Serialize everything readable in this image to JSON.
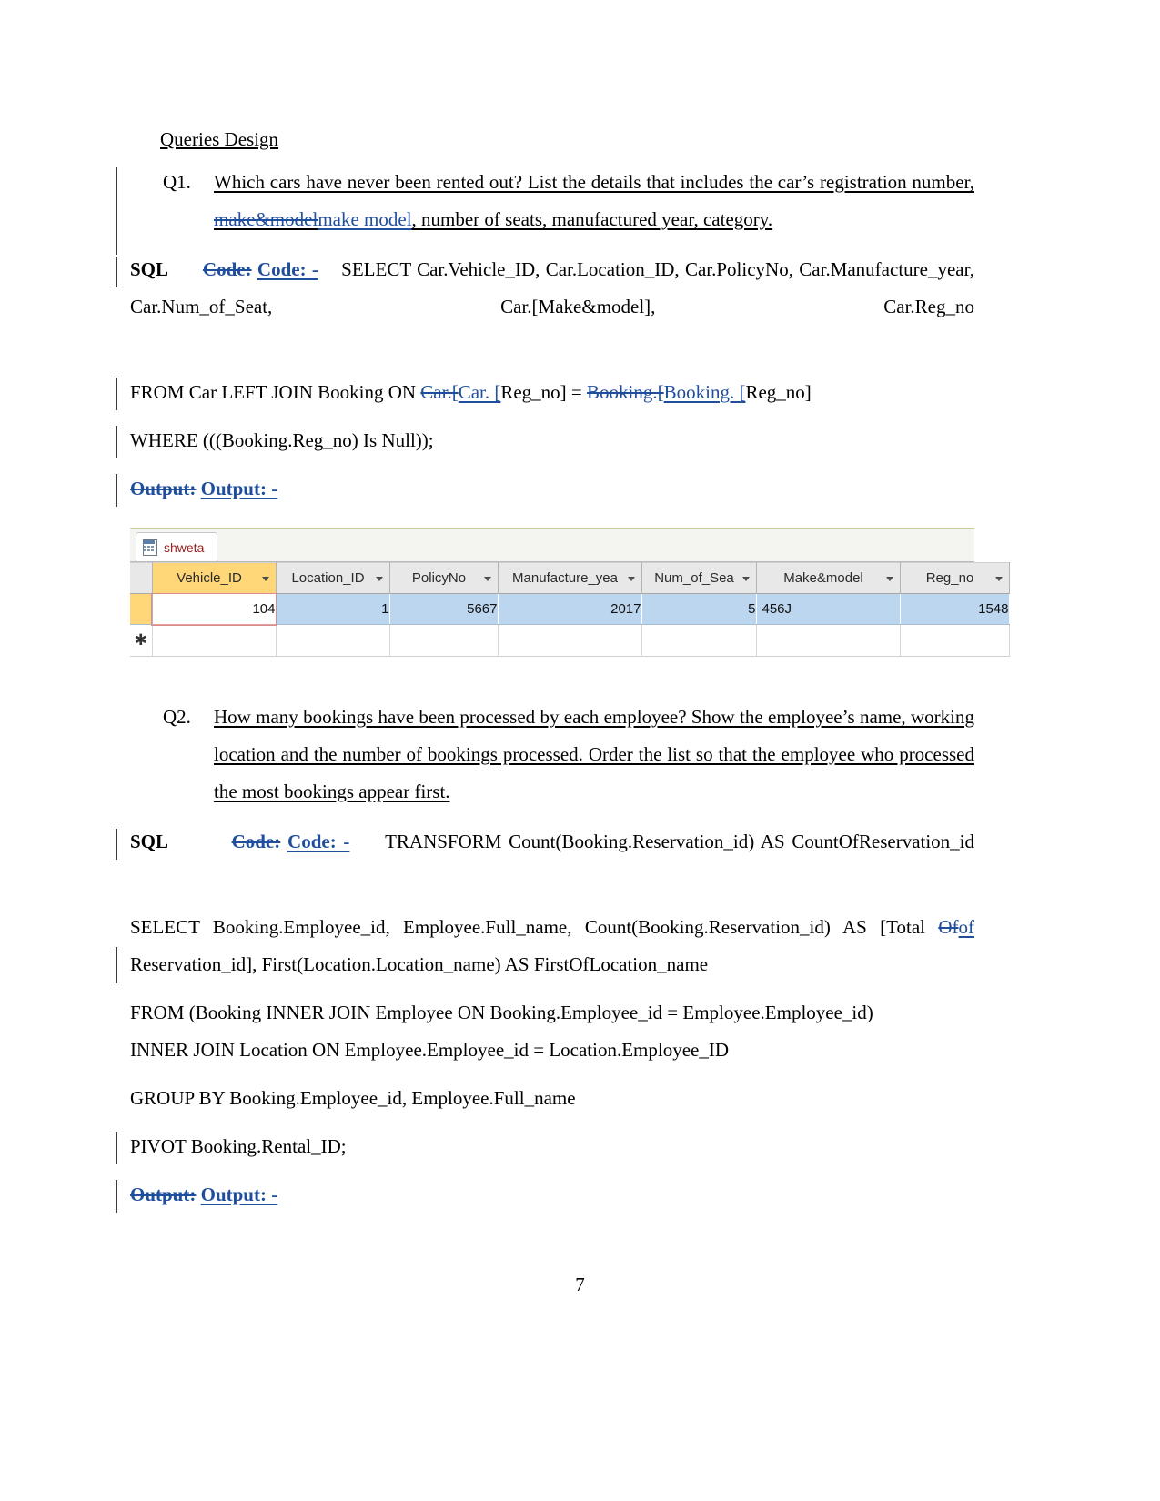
{
  "document": {
    "heading": "Queries Design",
    "page_number": "7"
  },
  "q1": {
    "number": "Q1.",
    "text_part1": "Which cars have never been rented out? List the details that includes the car’s registration number,",
    "deleted_term": "make&model",
    "inserted_term": "make model",
    "text_part2": ", number of seats, manufactured year, category.",
    "sql_label": "SQL",
    "code_deleted": "Code:",
    "code_inserted": "Code:    -",
    "code_line1": "SELECT Car.Vehicle_ID, Car.Location_ID, Car.PolicyNo, Car.Manufacture_year, Car.Num_of_Seat, Car.[Make&model], Car.Reg_no",
    "code_line2_pre": "FROM Car LEFT JOIN Booking ON ",
    "code_line2_del1": "Car.[",
    "code_line2_ins1": "Car. [",
    "code_line2_mid": "Reg_no] = ",
    "code_line2_del2": "Booking.[",
    "code_line2_ins2": "Booking. [",
    "code_line2_end": "Reg_no]",
    "code_line3": "WHERE (((Booking.Reg_no) Is Null));",
    "output_deleted": "Output:",
    "output_inserted": "Output: -"
  },
  "access_table": {
    "tab_label": "shweta",
    "tab_icon": "table-datasheet-icon",
    "columns": [
      {
        "header": "Vehicle_ID",
        "selected": true
      },
      {
        "header": "Location_ID",
        "selected": false
      },
      {
        "header": "PolicyNo",
        "selected": false
      },
      {
        "header": "Manufacture_yea",
        "selected": false
      },
      {
        "header": "Num_of_Sea",
        "selected": false
      },
      {
        "header": "Make&model",
        "selected": false
      },
      {
        "header": "Reg_no",
        "selected": false
      }
    ],
    "rows": [
      {
        "Vehicle_ID": "104",
        "Location_ID": "1",
        "PolicyNo": "5667",
        "Manufacture_year": "2017",
        "Num_of_Seats": "5",
        "Make_model": "456J",
        "Reg_no": "1548"
      }
    ],
    "new_record_marker": "✱",
    "colors": {
      "selected_header": "#ffd778",
      "row_highlight": "#bcd6f0",
      "tab_text": "#9b1d1d"
    }
  },
  "q2": {
    "number": "Q2.",
    "text": "How many bookings have been processed by each employee? Show the employee’s name, working location and the number of bookings processed. Order the list so that the employee who processed the most bookings appear first.",
    "sql_label": "SQL",
    "code_deleted": "Code:",
    "code_inserted": "Code:       -",
    "code_line1": "TRANSFORM Count(Booking.Reservation_id) AS CountOfReservation_id",
    "code_line2_pre": "SELECT  Booking.Employee_id,  Employee.Full_name,  Count(Booking.Reservation_id)  AS [Total ",
    "code_line2_del": "Of",
    "code_line2_ins": "of",
    "code_line2_post": " Reservation_id], First(Location.Location_name) AS FirstOfLocation_name",
    "code_line3a": "FROM (Booking INNER JOIN Employee ON Booking.Employee_id = Employee.Employee_id)",
    "code_line3b": "INNER JOIN Location ON Employee.Employee_id = Location.Employee_ID",
    "code_line4": "GROUP BY Booking.Employee_id, Employee.Full_name",
    "code_line5": "PIVOT Booking.Rental_ID;",
    "output_deleted": "Output:",
    "output_inserted": "Output: -"
  },
  "colors": {
    "tracked_change": "#1F4E9C",
    "change_bar": "#3a3a3a"
  }
}
